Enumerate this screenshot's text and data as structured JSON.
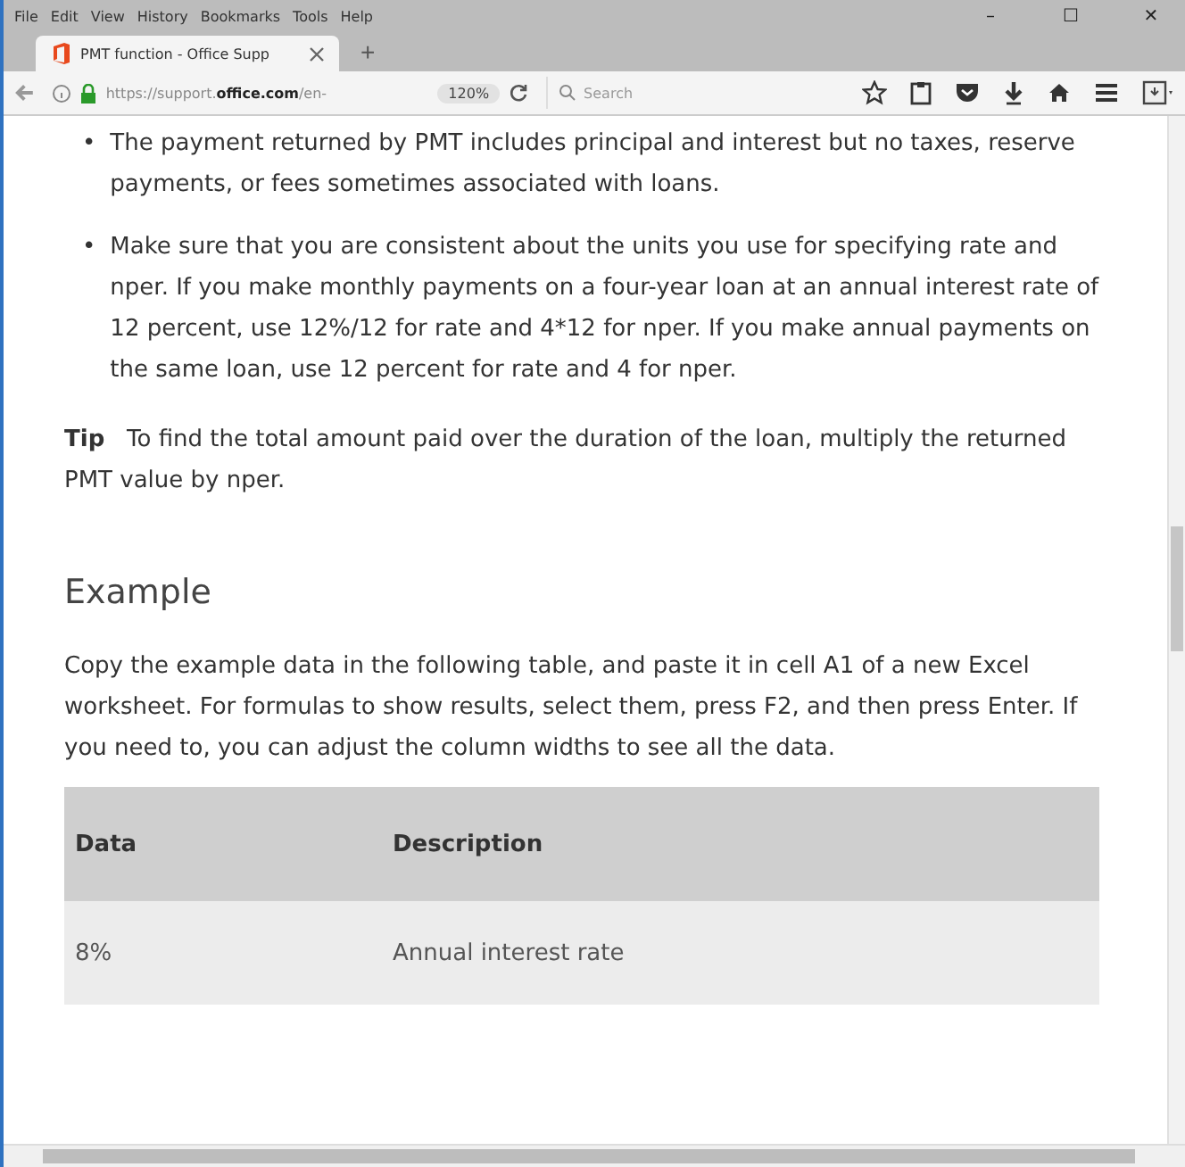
{
  "menu_bar": {
    "items": [
      "File",
      "Edit",
      "View",
      "History",
      "Bookmarks",
      "Tools",
      "Help"
    ]
  },
  "window_controls": [
    "–",
    "☐",
    "✕"
  ],
  "tabs": [
    {
      "title": "PMT function - Office Supp",
      "selected": true
    }
  ],
  "new_tab": "+",
  "address_bar": {
    "url_plain": "https://support.",
    "url_domain": "office.com",
    "url_rest": "/en-",
    "zoom": "120%"
  },
  "search": {
    "placeholder": "Search"
  },
  "bullet_marker": "•",
  "bullets": [
    "The payment returned by PMT includes principal and interest but no taxes, reserve payments, or fees sometimes associated with loans.",
    "Make sure that you are consistent about the units you use for specifying rate and nper. If you make monthly payments on a four-year loan at an annual interest rate of 12 percent, use 12%/12 for rate and 4*12 for nper. If you make annual payments on the same loan, use 12 percent for rate and 4 for nper."
  ],
  "tip": "**Tip**   To find the total amount paid over the duration of the loan, multiply the returned PMT value by nper.",
  "heading": "Example",
  "intro": "Copy the example data in the following table, and paste it in cell A1 of a new Excel worksheet. For formulas to show results, select them, press F2, and then press Enter. If you need to, you can adjust the column widths to see all the data.",
  "table": {
    "columns": [
      "Data",
      "Description"
    ],
    "rows": [
      [
        "8%",
        "Annual interest rate"
      ]
    ]
  }
}
